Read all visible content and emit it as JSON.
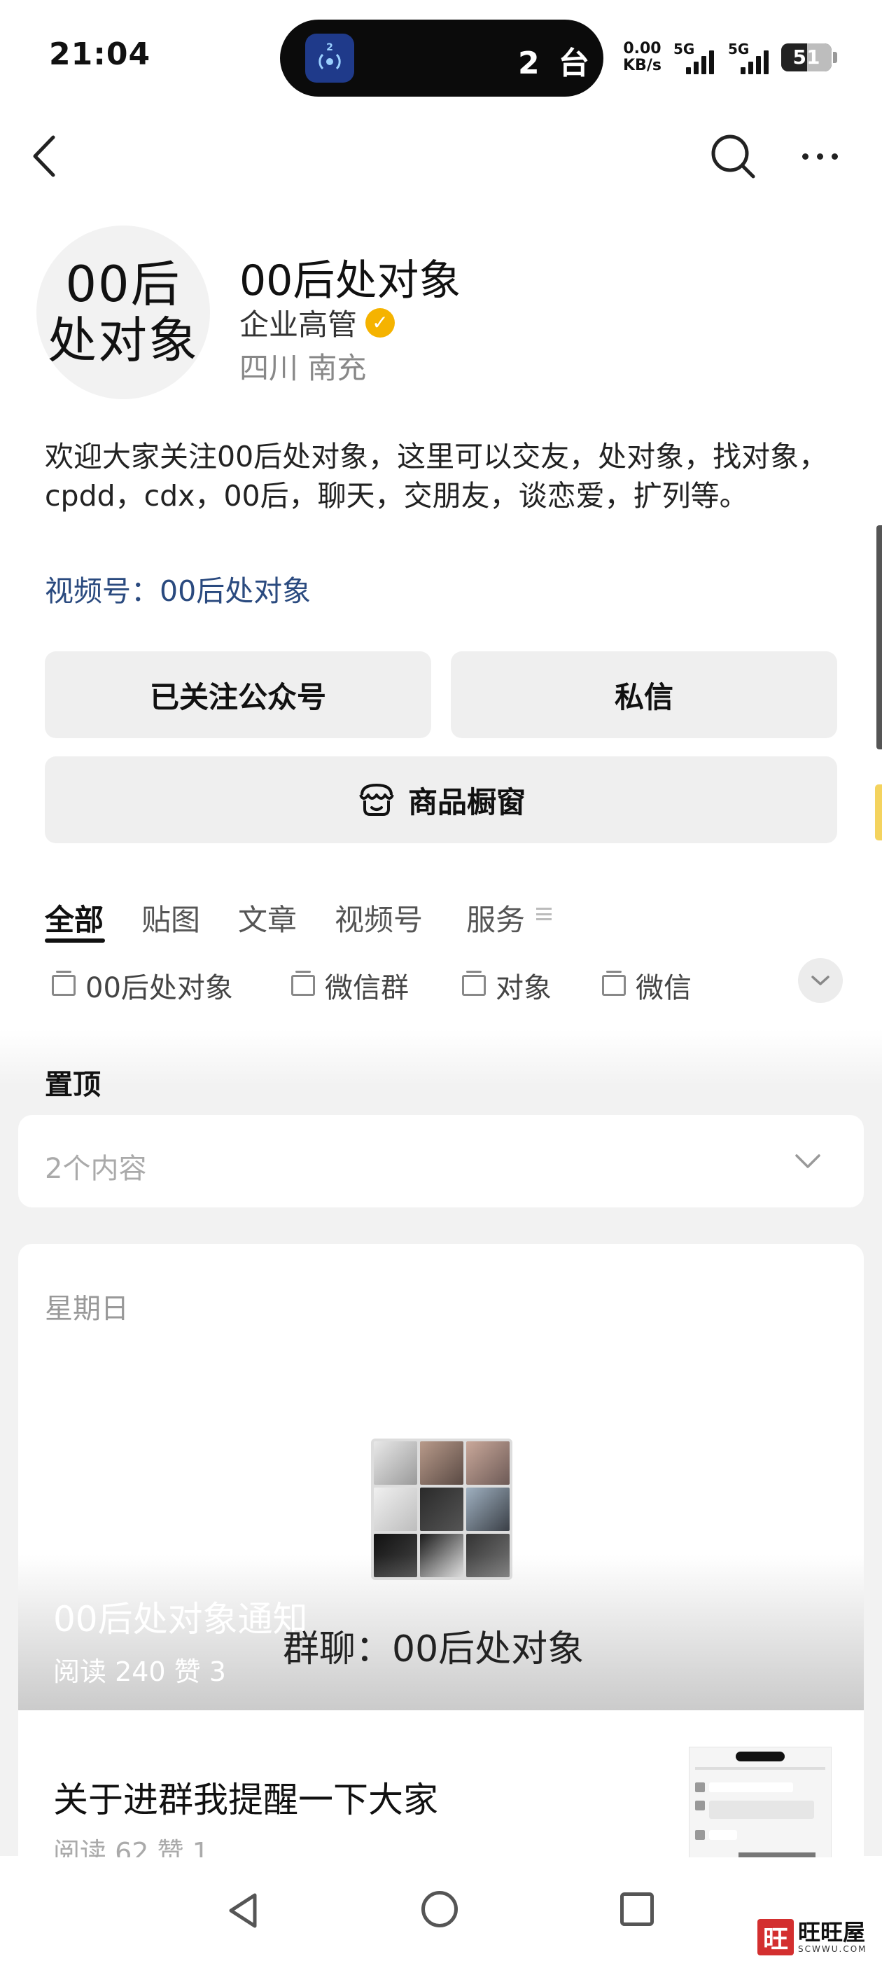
{
  "status_bar": {
    "time": "21:04",
    "island_badge": "2",
    "island_text": "2 台",
    "net_speed_value": "0.00",
    "net_speed_unit": "KB/s",
    "signal1_label": "5G",
    "signal2_label": "5G",
    "battery": "51",
    "battery_level": 0.51
  },
  "nav": {
    "back_icon": "chevron-left-icon",
    "search_icon": "search-icon",
    "more_icon": "more-horizontal-icon"
  },
  "profile": {
    "avatar_line1": "00后",
    "avatar_line2": "处对象",
    "name": "00后处对象",
    "type": "企业高管",
    "location": "四川 南充",
    "bio": "欢迎大家关注00后处对象，这里可以交友，处对象，找对象，cpdd，cdx，00后，聊天，交朋友，谈恋爱，扩列等。",
    "channel_link": "视频号：00后处对象"
  },
  "actions": {
    "follow_label": "已关注公众号",
    "message_label": "私信",
    "shop_label": "商品橱窗"
  },
  "tabs": [
    {
      "label": "全部",
      "active": true
    },
    {
      "label": "贴图"
    },
    {
      "label": "文章"
    },
    {
      "label": "视频号"
    },
    {
      "label": "服务"
    }
  ],
  "tags": [
    "00后处对象",
    "微信群",
    "对象",
    "微信"
  ],
  "pinned": {
    "label": "置顶",
    "count_text": "2个内容"
  },
  "posts": {
    "day": "星期日",
    "main_title": "00后处对象通知",
    "main_stats": "阅读 240   赞 3",
    "group_caption": "群聊：00后处对象",
    "article_title": "关于进群我提醒一下大家",
    "article_stats": "阅读 62   赞 1"
  },
  "watermark": {
    "logo": "旺",
    "text": "旺旺屋",
    "url": "SCWWU.COM"
  }
}
